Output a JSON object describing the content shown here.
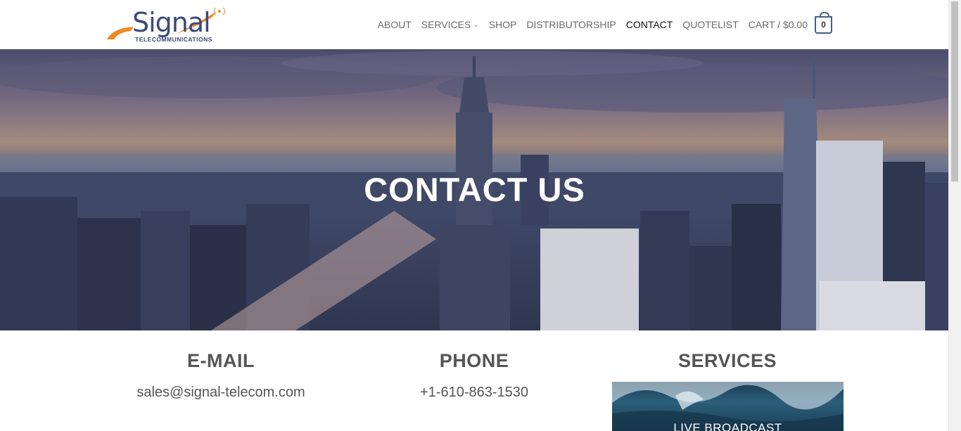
{
  "logo": {
    "brand": "Signal",
    "tagline": "TELECOMMUNICATIONS"
  },
  "nav": {
    "items": [
      "ABOUT",
      "SERVICES",
      "SHOP",
      "DISTRIBUTORSHIP",
      "CONTACT",
      "QUOTELIST",
      "CART / $0.00"
    ],
    "cart_count": "0"
  },
  "hero": {
    "title": "CONTACT US"
  },
  "contact": {
    "email_heading": "E-MAIL",
    "email_value": "sales@signal-telecom.com",
    "phone_heading": "PHONE",
    "phone_value": "+1-610-863-1530",
    "services_heading": "SERVICES",
    "services_card_label": "LIVE BROADCAST"
  },
  "colors": {
    "accent": "#446084",
    "logo_orange": "#f08a24",
    "logo_blue": "#3b4a7a"
  },
  "icons": [
    "chevron-down-icon",
    "cart-icon",
    "signal-icon"
  ]
}
